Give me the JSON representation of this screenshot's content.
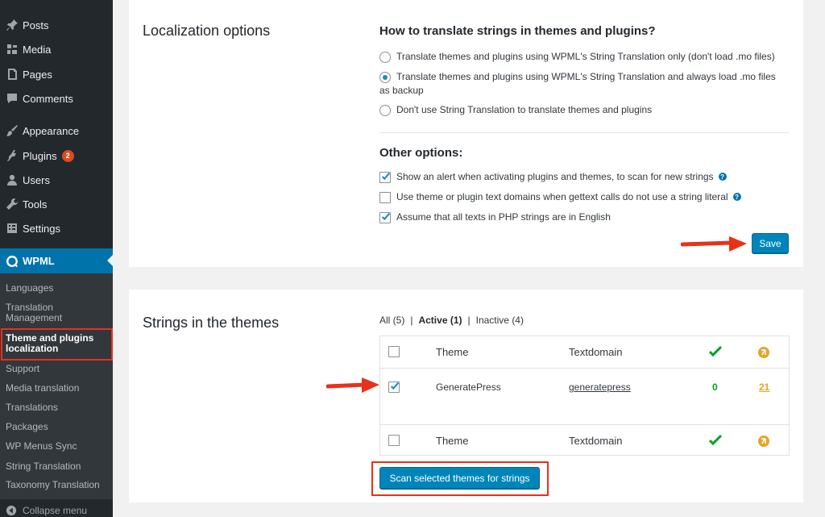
{
  "sidebar": {
    "items": [
      {
        "label": "Posts",
        "icon": "pin-icon"
      },
      {
        "label": "Media",
        "icon": "media-icon"
      },
      {
        "label": "Pages",
        "icon": "pages-icon"
      },
      {
        "label": "Comments",
        "icon": "comments-icon"
      },
      {
        "label": "Appearance",
        "icon": "brush-icon"
      },
      {
        "label": "Plugins",
        "icon": "plugin-icon",
        "badge": "2"
      },
      {
        "label": "Users",
        "icon": "user-icon"
      },
      {
        "label": "Tools",
        "icon": "wrench-icon"
      },
      {
        "label": "Settings",
        "icon": "settings-icon"
      }
    ],
    "active": {
      "label": "WPML",
      "icon": "wpml-icon"
    },
    "submenu": [
      "Languages",
      "Translation Management",
      "Theme and plugins localization",
      "Support",
      "Media translation",
      "Translations",
      "Packages",
      "WP Menus Sync",
      "String Translation",
      "Taxonomy Translation"
    ],
    "collapse_label": "Collapse menu"
  },
  "localization": {
    "section_title": "Localization options",
    "heading": "How to translate strings in themes and plugins?",
    "radio_options": [
      {
        "label": "Translate themes and plugins using WPML's String Translation only (don't load .mo files)",
        "selected": false
      },
      {
        "label": "Translate themes and plugins using WPML's String Translation and always load .mo files",
        "label2": "as backup",
        "selected": true
      },
      {
        "label": "Don't use String Translation to translate themes and plugins",
        "selected": false
      }
    ],
    "other_heading": "Other options:",
    "checkboxes": [
      {
        "label": "Show an alert when activating plugins and themes, to scan for new strings",
        "checked": true,
        "help": "?"
      },
      {
        "label": "Use theme or plugin text domains when gettext calls do not use a string literal",
        "checked": false,
        "help": "?"
      },
      {
        "label": "Assume that all texts in PHP strings are in English",
        "checked": true
      }
    ],
    "save_label": "Save"
  },
  "themes": {
    "section_title": "Strings in the themes",
    "filters": {
      "all": "All (5)",
      "active": "Active (1)",
      "inactive": "Inactive (4)",
      "separator": "|"
    },
    "header": {
      "theme": "Theme",
      "domain": "Textdomain"
    },
    "rows": [
      {
        "theme": "GeneratePress",
        "domain": "generatepress",
        "translated": "0",
        "untranslated": "21",
        "checked": true
      }
    ],
    "scan_label": "Scan selected themes for strings"
  },
  "colors": {
    "sidebar_bg": "#23282d",
    "submenu_bg": "#32373c",
    "accent": "#0073aa",
    "button": "#0085ba",
    "highlight": "#e8311a",
    "ok_green": "#00a32a",
    "pending_orange": "#e4a52a"
  }
}
